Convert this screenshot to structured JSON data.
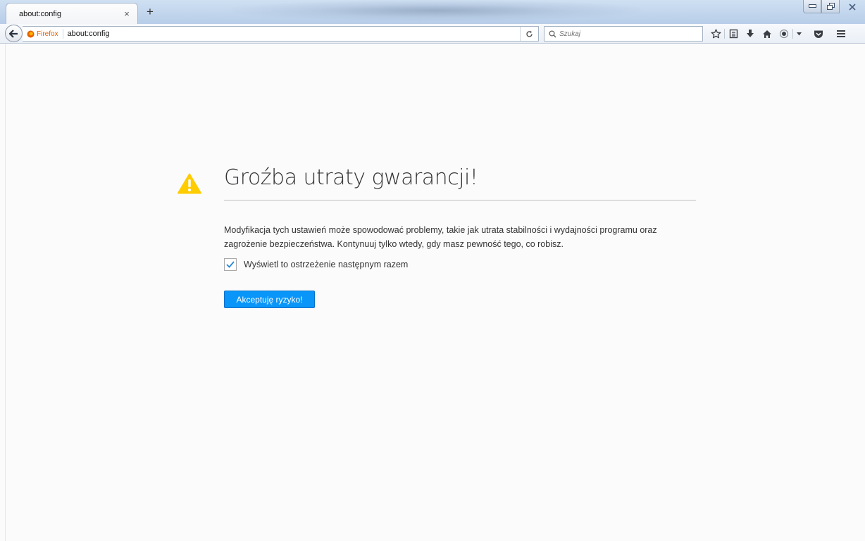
{
  "window": {
    "minimize_icon": "minimize-icon",
    "restore_icon": "restore-icon",
    "close_icon": "close-icon"
  },
  "tab": {
    "title": "about:config",
    "close_glyph": "×",
    "new_tab_glyph": "+"
  },
  "navbar": {
    "identity_label": "Firefox",
    "url": "about:config",
    "search_placeholder": "Szukaj"
  },
  "toolbar_icons": [
    "star-icon",
    "reading-list-icon",
    "download-icon",
    "home-icon",
    "hello-icon",
    "dropdown-icon",
    "pocket-icon",
    "menu-icon"
  ],
  "warning": {
    "title": "Groźba utraty gwarancji!",
    "description": "Modyfikacja tych ustawień może spowodować problemy, takie jak utrata stabilności i wydajności programu oraz zagrożenie bezpieczeństwa. Kontynuuj tylko wtedy, gdy masz pewność tego, co robisz.",
    "checkbox_label": "Wyświetl to ostrzeżenie następnym razem",
    "checkbox_checked": true,
    "accept_label": "Akceptuję ryzyko!"
  },
  "colors": {
    "accent": "#0996f8",
    "warning_yellow": "#ffcc00",
    "firefox_orange": "#e66000",
    "check_blue": "#2a88d8"
  }
}
